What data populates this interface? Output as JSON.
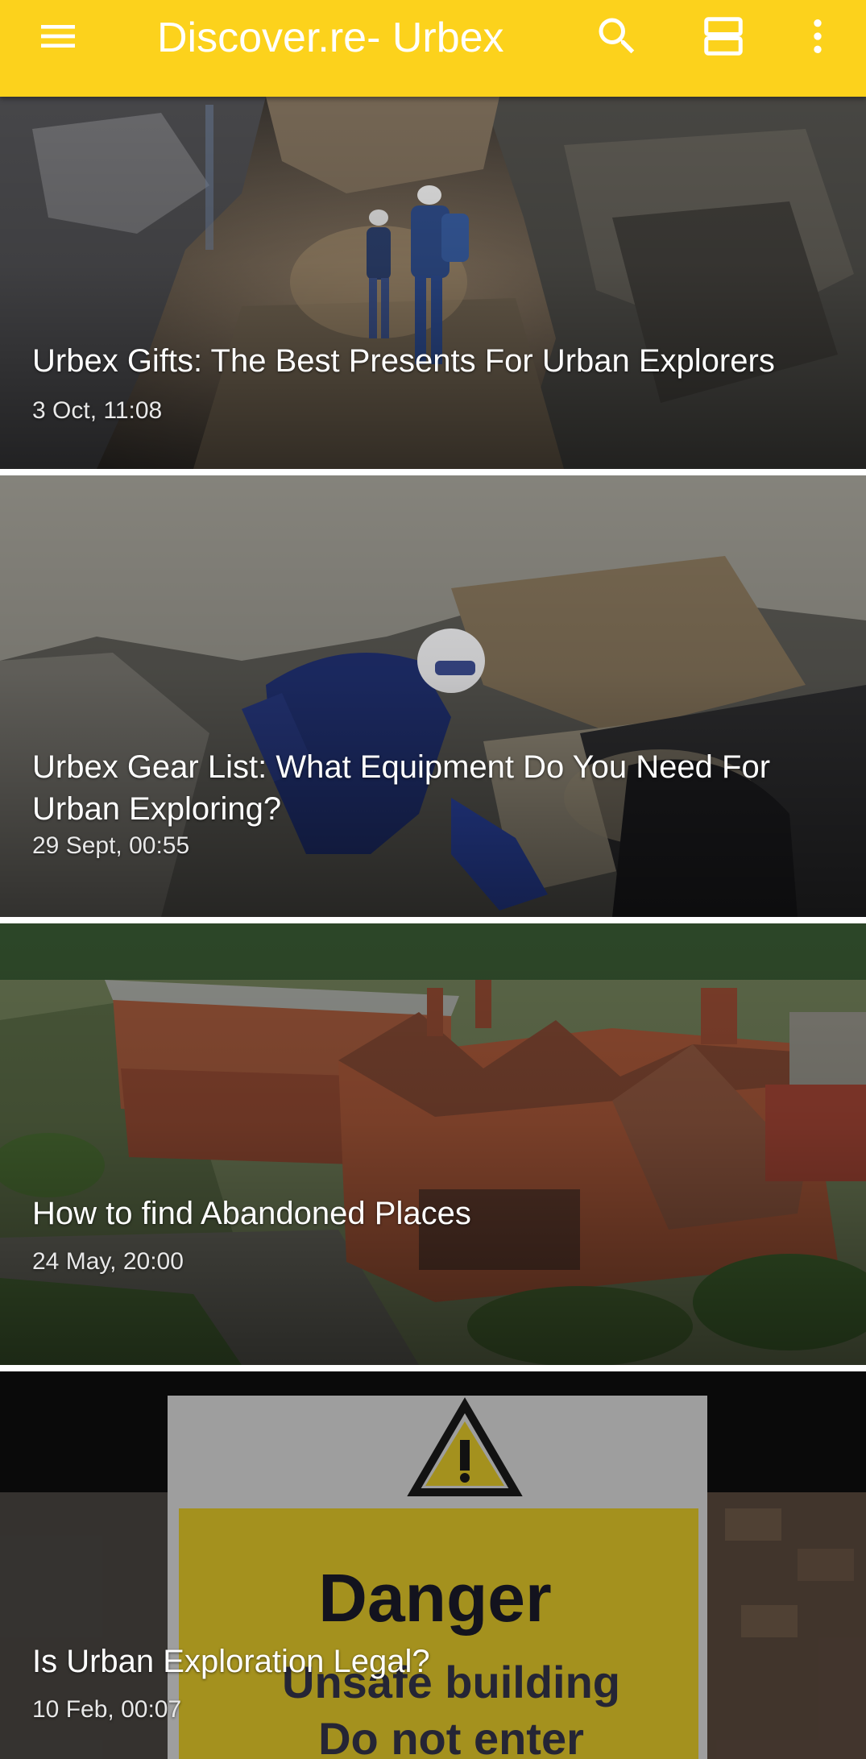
{
  "app_bar": {
    "title": "Discover.re- Urbex",
    "menu_icon": "hamburger-menu-icon",
    "search_icon": "search-icon",
    "layout_icon": "view-agenda-icon",
    "more_icon": "more-vert-icon",
    "background_color": "#fcd21c",
    "title_color": "#ffffff"
  },
  "articles": [
    {
      "title": "Urbex Gifts: The Best Presents For Urban Explorers",
      "date": "3 Oct, 11:08"
    },
    {
      "title": "Urbex Gear List: What Equipment Do You Need For Urban Exploring?",
      "date": "29 Sept, 00:55"
    },
    {
      "title": "How to find Abandoned Places",
      "date": "24 May, 20:00"
    },
    {
      "title": "Is Urban Exploration Legal?",
      "date": "10 Feb, 00:07",
      "sign": {
        "heading": "Danger",
        "line1": "Unsafe building",
        "line2": "Do not enter"
      }
    }
  ]
}
